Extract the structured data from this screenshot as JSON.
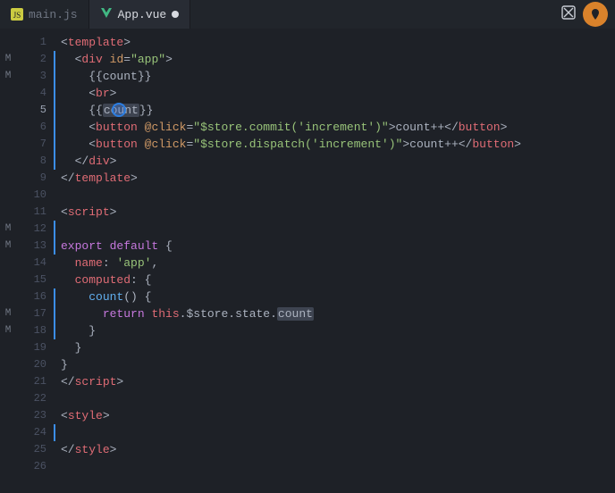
{
  "tabs": [
    {
      "label": "main.js",
      "icon": "JS",
      "active": false,
      "dirty": false
    },
    {
      "label": "App.vue",
      "icon": "V",
      "active": true,
      "dirty": true
    }
  ],
  "activeLine": 5,
  "cursor": {
    "line": 5,
    "col": 17
  },
  "leftMarkers": {
    "2": "M",
    "3": "M",
    "12": "M",
    "13": "M",
    "17": "M",
    "18": "M"
  },
  "modifiedBars": [
    {
      "from": 2,
      "to": 8
    },
    {
      "from": 12,
      "to": 13
    },
    {
      "from": 16,
      "to": 18
    },
    {
      "from": 24,
      "to": 24
    }
  ],
  "code": {
    "lines": [
      {
        "n": 1,
        "indent": 0,
        "t": [
          [
            "pnc",
            "<"
          ],
          [
            "tag",
            "template"
          ],
          [
            "pnc",
            ">"
          ]
        ]
      },
      {
        "n": 2,
        "indent": 1,
        "t": [
          [
            "pnc",
            "<"
          ],
          [
            "tag",
            "div"
          ],
          [
            "pl",
            " "
          ],
          [
            "attr",
            "id"
          ],
          [
            "pnc",
            "="
          ],
          [
            "str",
            "\"app\""
          ],
          [
            "pnc",
            ">"
          ]
        ]
      },
      {
        "n": 3,
        "indent": 2,
        "t": [
          [
            "pnc",
            "{{"
          ],
          [
            "pl",
            "count"
          ],
          [
            "pnc",
            "}}"
          ]
        ]
      },
      {
        "n": 4,
        "indent": 2,
        "t": [
          [
            "pnc",
            "<"
          ],
          [
            "tag",
            "br"
          ],
          [
            "pnc",
            ">"
          ]
        ]
      },
      {
        "n": 5,
        "indent": 2,
        "t": [
          [
            "pnc",
            "{{"
          ],
          [
            "hl",
            "count"
          ],
          [
            "pnc",
            "}}"
          ]
        ]
      },
      {
        "n": 6,
        "indent": 2,
        "t": [
          [
            "pnc",
            "<"
          ],
          [
            "tag",
            "button"
          ],
          [
            "pl",
            " "
          ],
          [
            "attr",
            "@click"
          ],
          [
            "pnc",
            "="
          ],
          [
            "str",
            "\"$store.commit('increment')\""
          ],
          [
            "pnc",
            ">"
          ],
          [
            "pl",
            "count++"
          ],
          [
            "pnc",
            "</"
          ],
          [
            "tag",
            "button"
          ],
          [
            "pnc",
            ">"
          ]
        ]
      },
      {
        "n": 7,
        "indent": 2,
        "t": [
          [
            "pnc",
            "<"
          ],
          [
            "tag",
            "button"
          ],
          [
            "pl",
            " "
          ],
          [
            "attr",
            "@click"
          ],
          [
            "pnc",
            "="
          ],
          [
            "str",
            "\"$store.dispatch('increment')\""
          ],
          [
            "pnc",
            ">"
          ],
          [
            "pl",
            "count++"
          ],
          [
            "pnc",
            "</"
          ],
          [
            "tag",
            "button"
          ],
          [
            "pnc",
            ">"
          ]
        ]
      },
      {
        "n": 8,
        "indent": 1,
        "t": [
          [
            "pnc",
            "</"
          ],
          [
            "tag",
            "div"
          ],
          [
            "pnc",
            ">"
          ]
        ]
      },
      {
        "n": 9,
        "indent": 0,
        "t": [
          [
            "pnc",
            "</"
          ],
          [
            "tag",
            "template"
          ],
          [
            "pnc",
            ">"
          ]
        ]
      },
      {
        "n": 10,
        "indent": 0,
        "t": []
      },
      {
        "n": 11,
        "indent": 0,
        "t": [
          [
            "pnc",
            "<"
          ],
          [
            "tag",
            "script"
          ],
          [
            "pnc",
            ">"
          ]
        ]
      },
      {
        "n": 12,
        "indent": 0,
        "t": []
      },
      {
        "n": 13,
        "indent": 0,
        "t": [
          [
            "kw",
            "export"
          ],
          [
            "pl",
            " "
          ],
          [
            "kw",
            "default"
          ],
          [
            "pl",
            " "
          ],
          [
            "pnc",
            "{"
          ]
        ]
      },
      {
        "n": 14,
        "indent": 1,
        "t": [
          [
            "prop",
            "name"
          ],
          [
            "pnc",
            ": "
          ],
          [
            "str",
            "'app'"
          ],
          [
            "pnc",
            ","
          ]
        ]
      },
      {
        "n": 15,
        "indent": 1,
        "t": [
          [
            "prop",
            "computed"
          ],
          [
            "pnc",
            ": {"
          ]
        ]
      },
      {
        "n": 16,
        "indent": 2,
        "t": [
          [
            "fn",
            "count"
          ],
          [
            "pnc",
            "() {"
          ]
        ]
      },
      {
        "n": 17,
        "indent": 3,
        "t": [
          [
            "kw",
            "return"
          ],
          [
            "pl",
            " "
          ],
          [
            "id",
            "this"
          ],
          [
            "pnc",
            "."
          ],
          [
            "pl",
            "$store"
          ],
          [
            "pnc",
            "."
          ],
          [
            "pl",
            "state"
          ],
          [
            "pnc",
            "."
          ],
          [
            "hl",
            "count"
          ]
        ]
      },
      {
        "n": 18,
        "indent": 2,
        "t": [
          [
            "pnc",
            "}"
          ]
        ]
      },
      {
        "n": 19,
        "indent": 1,
        "t": [
          [
            "pnc",
            "}"
          ]
        ]
      },
      {
        "n": 20,
        "indent": 0,
        "t": [
          [
            "pnc",
            "}"
          ]
        ]
      },
      {
        "n": 21,
        "indent": 0,
        "t": [
          [
            "pnc",
            "</"
          ],
          [
            "tag",
            "script"
          ],
          [
            "pnc",
            ">"
          ]
        ]
      },
      {
        "n": 22,
        "indent": 0,
        "t": []
      },
      {
        "n": 23,
        "indent": 0,
        "t": [
          [
            "pnc",
            "<"
          ],
          [
            "tag",
            "style"
          ],
          [
            "pnc",
            ">"
          ]
        ]
      },
      {
        "n": 24,
        "indent": 0,
        "t": []
      },
      {
        "n": 25,
        "indent": 0,
        "t": [
          [
            "pnc",
            "</"
          ],
          [
            "tag",
            "style"
          ],
          [
            "pnc",
            ">"
          ]
        ]
      },
      {
        "n": 26,
        "indent": 0,
        "t": []
      }
    ]
  }
}
